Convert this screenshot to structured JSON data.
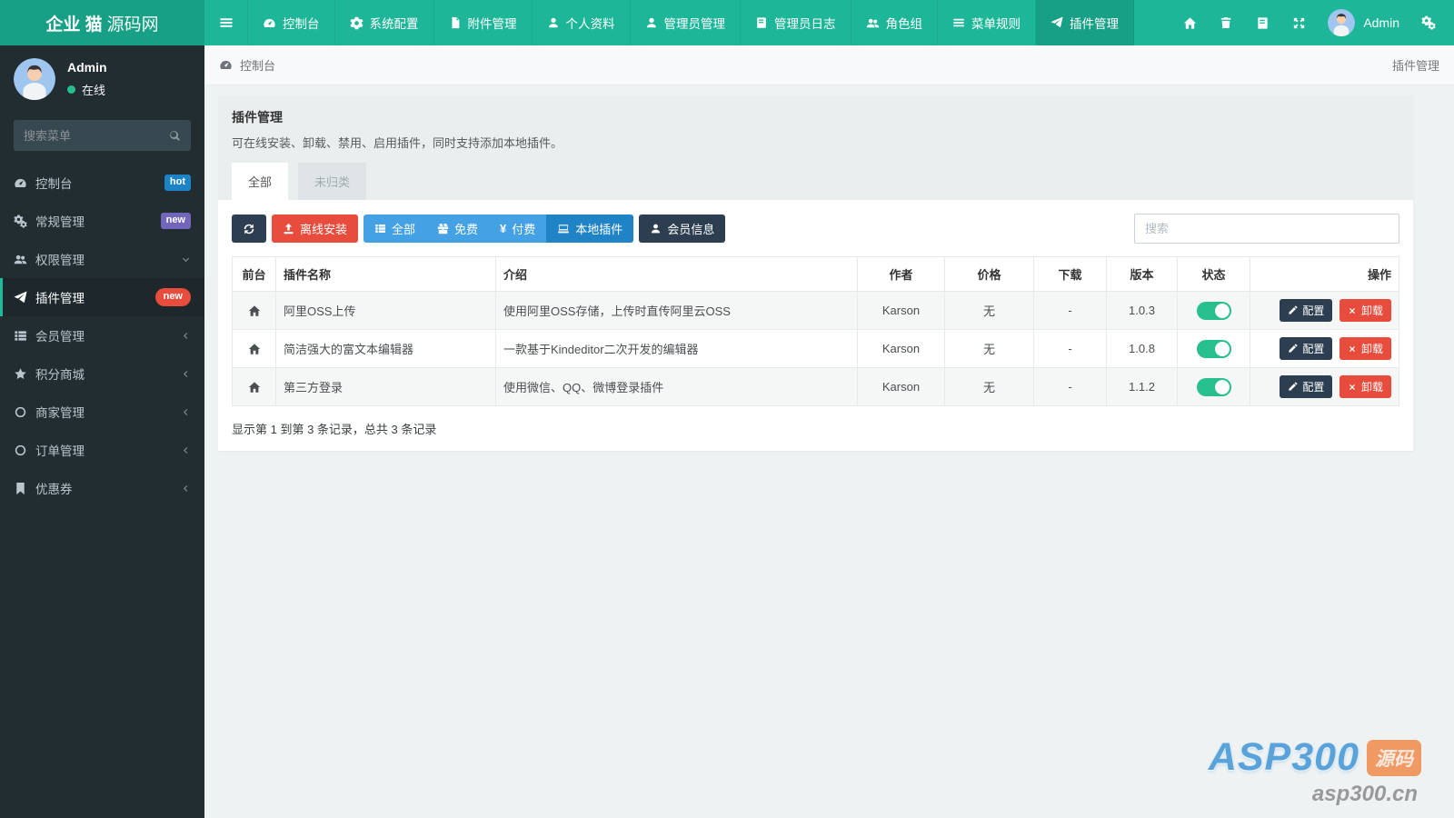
{
  "colors": {
    "navbar_teal": "#1EB698",
    "navbar_dark_teal": "#17A085",
    "sidebar_bg": "#222D32",
    "sidebar_active_accent": "#1ABC9C",
    "badge_hot_blue": "#1C84C6",
    "badge_new_purple": "#7266BA",
    "badge_new_red": "#E74C3C",
    "button_dark": "#2C3E50",
    "button_red": "#E74C3C",
    "button_blue": "#43A1E4",
    "button_blue_active": "#2083C6",
    "toggle_on_green": "#26BF8D"
  },
  "topbar": {
    "logo_bold": "企业 猫",
    "logo_light": "源码网",
    "nav": [
      {
        "label": "控制台",
        "icon": "dashboard-icon"
      },
      {
        "label": "系统配置",
        "icon": "gear-icon"
      },
      {
        "label": "附件管理",
        "icon": "file-icon"
      },
      {
        "label": "个人资料",
        "icon": "user-icon"
      },
      {
        "label": "管理员管理",
        "icon": "user-icon"
      },
      {
        "label": "管理员日志",
        "icon": "book-icon"
      },
      {
        "label": "角色组",
        "icon": "users-icon"
      },
      {
        "label": "菜单规则",
        "icon": "menu-icon"
      },
      {
        "label": "插件管理",
        "icon": "paper-plane-icon",
        "active": true
      }
    ],
    "username": "Admin"
  },
  "sidebar": {
    "username": "Admin",
    "status": "在线",
    "search_placeholder": "搜索菜单",
    "items": [
      {
        "label": "控制台",
        "icon": "dashboard-icon",
        "badge": "hot"
      },
      {
        "label": "常规管理",
        "icon": "cogs-icon",
        "badge": "new"
      },
      {
        "label": "权限管理",
        "icon": "users-icon"
      },
      {
        "label": "插件管理",
        "icon": "paper-plane-icon",
        "badge": "new",
        "active": true
      },
      {
        "label": "会员管理",
        "icon": "list-icon"
      },
      {
        "label": "积分商城",
        "icon": "star-icon"
      },
      {
        "label": "商家管理",
        "icon": "circle-icon"
      },
      {
        "label": "订单管理",
        "icon": "circle-icon"
      },
      {
        "label": "优惠券",
        "icon": "bookmark-icon"
      }
    ]
  },
  "breadcrumb": {
    "left": "控制台",
    "right": "插件管理"
  },
  "panel": {
    "title": "插件管理",
    "description": "可在线安装、卸载、禁用、启用插件，同时支持添加本地插件。",
    "tabs": [
      {
        "label": "全部",
        "active": true
      },
      {
        "label": "未归类",
        "active": false
      }
    ],
    "toolbar": {
      "offline_install": "离线安装",
      "filters": [
        {
          "label": "全部",
          "icon": "list-icon"
        },
        {
          "label": "免费",
          "icon": "gift-icon"
        },
        {
          "label": "付费",
          "icon": "yen-icon",
          "icon_char": "¥"
        },
        {
          "label": "本地插件",
          "icon": "laptop-icon",
          "active": true
        }
      ],
      "member_info": "会员信息",
      "search_placeholder": "搜索"
    },
    "table": {
      "headers": [
        "前台",
        "插件名称",
        "介绍",
        "作者",
        "价格",
        "下载",
        "版本",
        "状态",
        "操作"
      ],
      "rows": [
        {
          "name": "阿里OSS上传",
          "intro": "使用阿里OSS存储，上传时直传阿里云OSS",
          "author": "Karson",
          "price": "无",
          "downloads": "-",
          "version": "1.0.3",
          "status": "on"
        },
        {
          "name": "简洁强大的富文本编辑器",
          "intro": "一款基于Kindeditor二次开发的编辑器",
          "author": "Karson",
          "price": "无",
          "downloads": "-",
          "version": "1.0.8",
          "status": "on"
        },
        {
          "name": "第三方登录",
          "intro": "使用微信、QQ、微博登录插件",
          "author": "Karson",
          "price": "无",
          "downloads": "-",
          "version": "1.1.2",
          "status": "on"
        }
      ],
      "actions": {
        "configure": "配置",
        "uninstall": "卸载"
      }
    },
    "summary": "显示第 1 到第 3 条记录，总共 3 条记录"
  },
  "watermark": {
    "brand": "ASP300",
    "tag": "源码",
    "domain": "asp300.cn"
  }
}
